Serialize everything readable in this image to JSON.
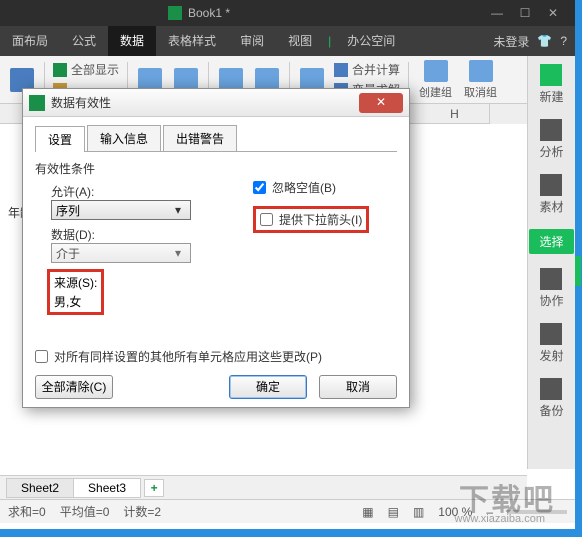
{
  "titlebar": {
    "doc": "Book1 *"
  },
  "menubar": {
    "items": [
      "面布局",
      "公式",
      "数据",
      "表格样式",
      "审阅",
      "视图"
    ],
    "active_index": 2,
    "office": "办公空间",
    "login": "未登录"
  },
  "toolbar": {
    "show_all": "全部显示",
    "merge_calc": "合并计算",
    "var_solve": "变量求解",
    "create_group": "创建组",
    "ungroup": "取消组"
  },
  "dialog": {
    "title": "数据有效性",
    "tabs": [
      "设置",
      "输入信息",
      "出错警告"
    ],
    "section_title": "有效性条件",
    "allow_label": "允许(A):",
    "allow_value": "序列",
    "data_label": "数据(D):",
    "data_value": "介于",
    "source_label": "来源(S):",
    "source_value": "男,女",
    "ignore_blank": "忽略空值(B)",
    "dropdown_arrow": "提供下拉箭头(I)",
    "apply_all": "对所有同样设置的其他所有单元格应用这些更改(P)",
    "clear_all": "全部清除(C)",
    "ok": "确定",
    "cancel": "取消"
  },
  "sheet": {
    "col_h": "H",
    "row_label": "年龄"
  },
  "rightpanel": {
    "items": [
      "新建",
      "分析",
      "素材",
      "选择",
      "协作",
      "发射",
      "备份"
    ],
    "sel_index": 3
  },
  "tabs": {
    "s2": "Sheet2",
    "s3": "Sheet3",
    "add": "+"
  },
  "status": {
    "sum": "求和=0",
    "avg": "平均值=0",
    "count": "计数=2",
    "zoom": "100 %"
  },
  "watermark": {
    "text": "下载吧",
    "url": "www.xiazaiba.com"
  }
}
